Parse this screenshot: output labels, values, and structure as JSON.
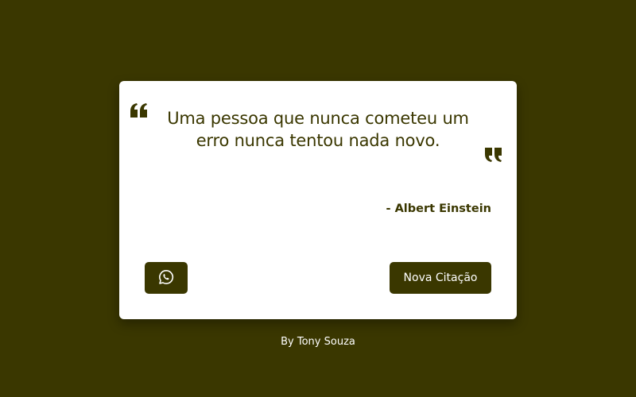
{
  "colors": {
    "background": "#3a3700",
    "card": "#ffffff",
    "accent": "#3a3700",
    "button_text": "#ffffff"
  },
  "quote": {
    "text": "Uma pessoa que nunca cometeu um erro nunca tentou nada novo.",
    "author": "- Albert Einstein",
    "open_mark_icon": "quote-open-icon",
    "close_mark_icon": "quote-close-icon"
  },
  "actions": {
    "share_icon": "whatsapp-icon",
    "new_quote_label": "Nova Citação"
  },
  "footer": {
    "credit": "By Tony Souza"
  }
}
